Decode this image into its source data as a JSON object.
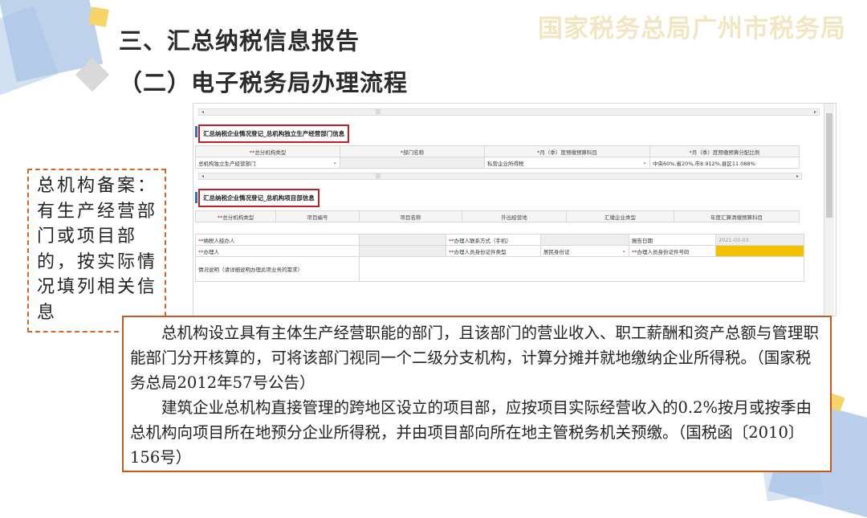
{
  "slide": {
    "brand": "国家税务总局广州市税务局",
    "title_main": "三、汇总纳税信息报告",
    "title_sub": "（二）电子税务局办理流程"
  },
  "screenshot": {
    "section1": {
      "title": "汇总纳税企业情况登记_总机构独立生产经营部门信息",
      "columns": [
        "*总分机构类型",
        "*部门名称",
        "*月（季）度预缴预算科目",
        "*月（季）度预缴预算分配比例"
      ],
      "row": {
        "type": "总机构独立生产经营部门",
        "dept_name": "",
        "subject": "私营企业所得税",
        "ratio": "中央60%,省20%,市8.912%,县区11.088%"
      }
    },
    "section2": {
      "title": "汇总纳税企业情况登记_总机构项目部信息",
      "columns": [
        "*总分机构类型",
        "项目编号",
        "项目名称",
        "外出经营地",
        "汇缴企业类型",
        "年度汇算清缴预算科目"
      ]
    },
    "form": {
      "taxpayer_handler_label": "*纳税人经办人",
      "contact_label": "*办理人联系方式（手机）",
      "report_date_label": "报告日期",
      "report_date_value": "2021-03-03",
      "handler_label": "*办理人",
      "id_type_label": "*办理人员身份证件类型",
      "id_type_value": "居民身份证",
      "id_no_label": "*办理人员身份证件号码",
      "remark_label": "情况说明（请详细说明办理此项业务的需求）"
    }
  },
  "annotation": {
    "text": "总机构备案：有生产经营部门或项目部的，按实际情况填列相关信息"
  },
  "explanation": {
    "para1": "总机构设立具有主体生产经营职能的部门，且该部门的营业收入、职工薪酬和资产总额与管理职能部门分开核算的，可将该部门视同一个二级分支机构，计算分摊并就地缴纳企业所得税。（国家税务总局2012年57号公告）",
    "para2": "建筑企业总机构直接管理的跨地区设立的项目部，应按项目实际经营收入的0.2%按月或按季由总机构向项目所在地预分企业所得税，并由项目部向所在地主管税务机关预缴。（国税函〔2010〕156号）"
  },
  "colors": {
    "accent_red": "#c0202a",
    "note_border": "#c65a1e",
    "section_bar": "#2f6fca",
    "highlight_input": "#f2c200"
  }
}
